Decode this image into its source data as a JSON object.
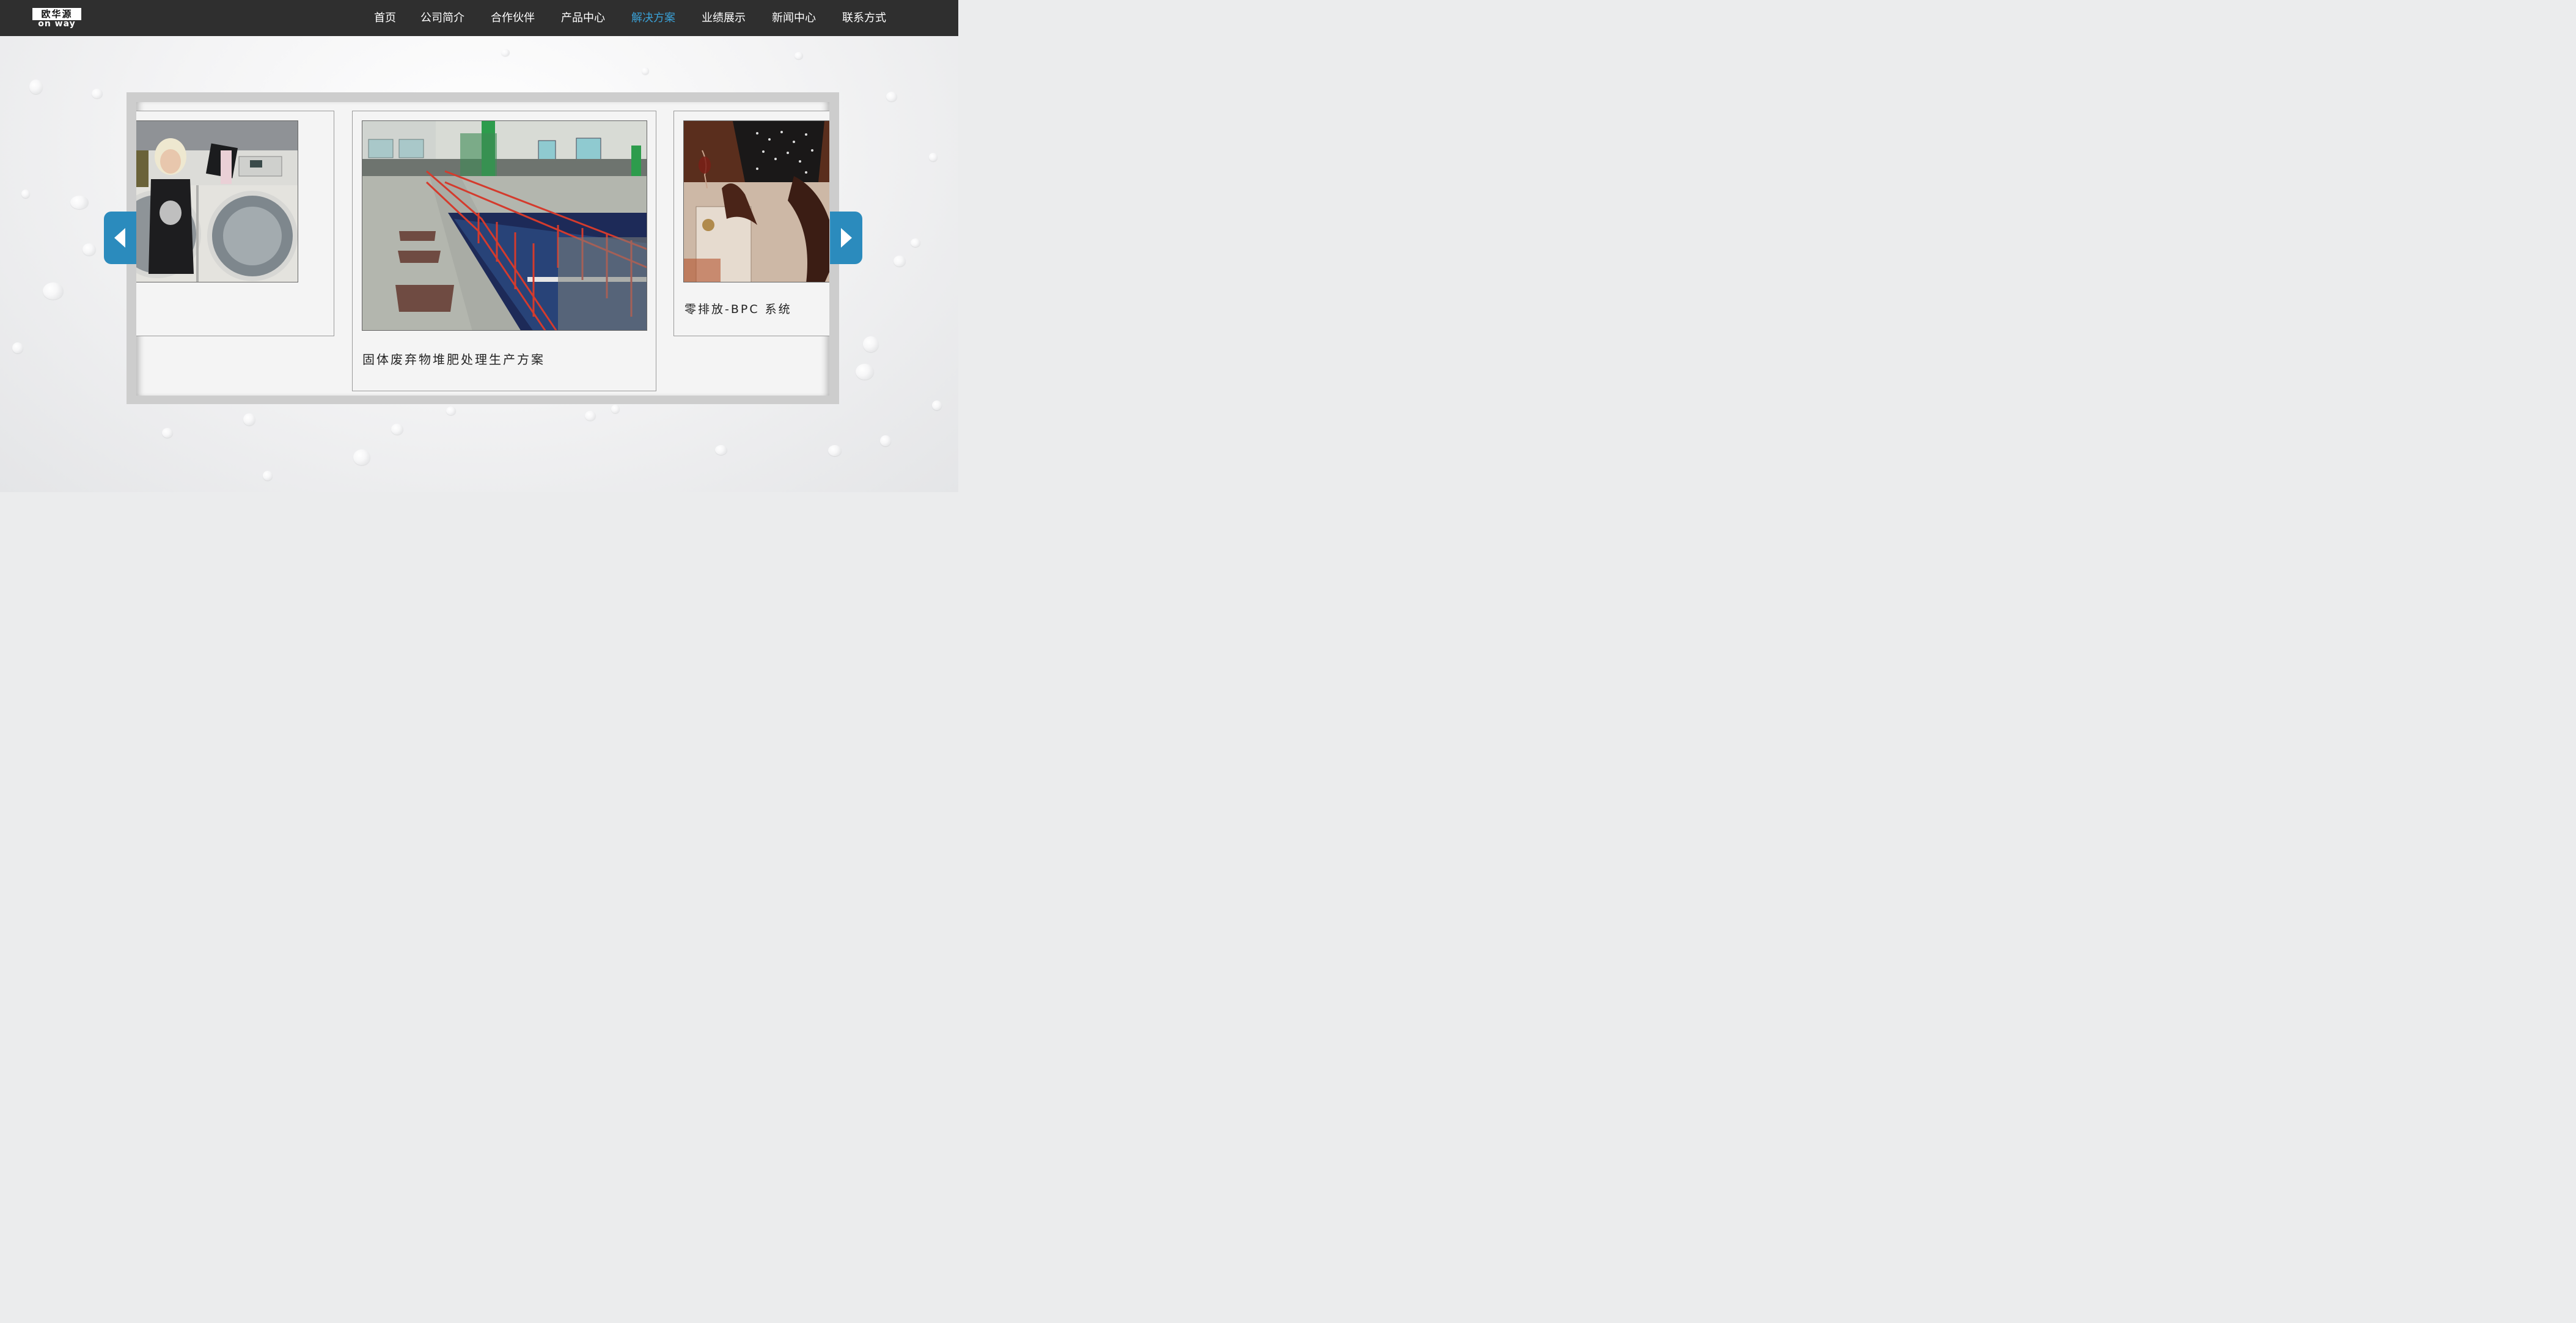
{
  "brand": {
    "logo_cn": "欧华源",
    "logo_en": "on way"
  },
  "nav": {
    "items": [
      {
        "label": "首页"
      },
      {
        "label": "公司简介"
      },
      {
        "label": "合作伙伴"
      },
      {
        "label": "产品中心"
      },
      {
        "label": "解决方案"
      },
      {
        "label": "业绩展示"
      },
      {
        "label": "新闻中心"
      },
      {
        "label": "联系方式"
      }
    ],
    "active": "解决方案",
    "active_color": "#3aa0d5"
  },
  "slider": {
    "slides": [
      {
        "caption": "",
        "image": "laundry-photo"
      },
      {
        "caption": "固体废弃物堆肥处理生产方案",
        "image": "factory-compost-photo"
      },
      {
        "caption": "零排放-BPC 系统",
        "image": "dishwasher-photo"
      }
    ],
    "prev_icon": "chevron-left-icon",
    "next_icon": "chevron-right-icon",
    "accent_color": "#2b8bbd"
  }
}
